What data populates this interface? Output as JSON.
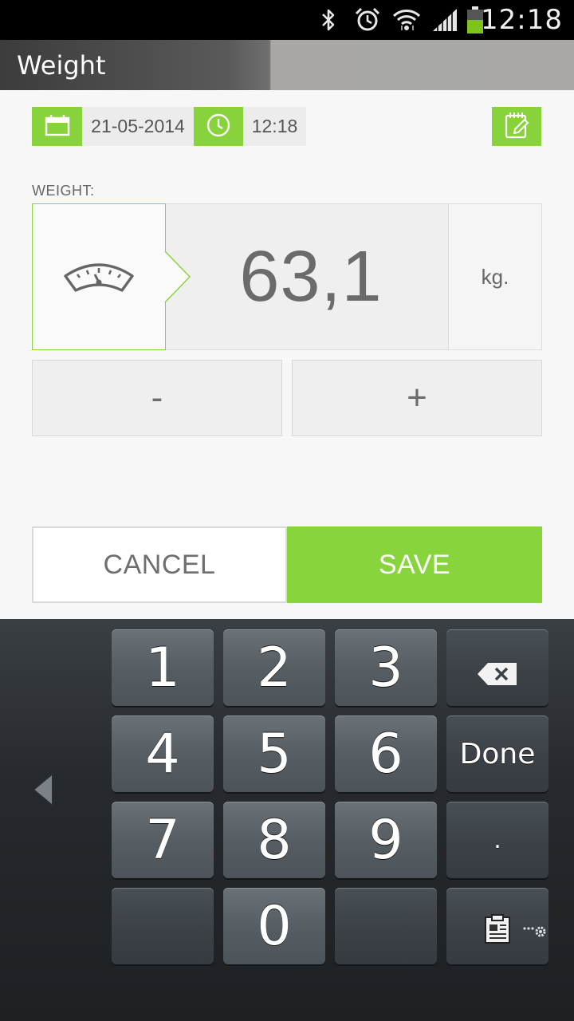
{
  "status_bar": {
    "time": "12:18",
    "icons": [
      "bluetooth-icon",
      "alarm-icon",
      "wifi-icon",
      "signal-icon",
      "battery-icon"
    ]
  },
  "header": {
    "title": "Weight"
  },
  "datetime": {
    "date": "21-05-2014",
    "time": "12:18",
    "date_icon": "calendar-icon",
    "time_icon": "clock-icon",
    "note_icon": "notepad-edit-icon"
  },
  "weight": {
    "label": "WEIGHT:",
    "value": "63,1",
    "unit": "kg.",
    "scale_icon": "scale-icon"
  },
  "stepper": {
    "minus": "-",
    "plus": "+"
  },
  "actions": {
    "cancel": "CANCEL",
    "save": "SAVE"
  },
  "keyboard": {
    "keys": {
      "k1": "1",
      "k2": "2",
      "k3": "3",
      "k4": "4",
      "k5": "5",
      "k6": "6",
      "k7": "7",
      "k8": "8",
      "k9": "9",
      "k0": "0",
      "done": "Done",
      "dot": "."
    },
    "icons": [
      "backspace-icon",
      "left-arrow-icon",
      "clipboard-icon",
      "settings-icon"
    ]
  },
  "colors": {
    "accent_green": "#88d23b",
    "status_bar_bg": "#000000",
    "keyboard_bg": "#26292d"
  }
}
